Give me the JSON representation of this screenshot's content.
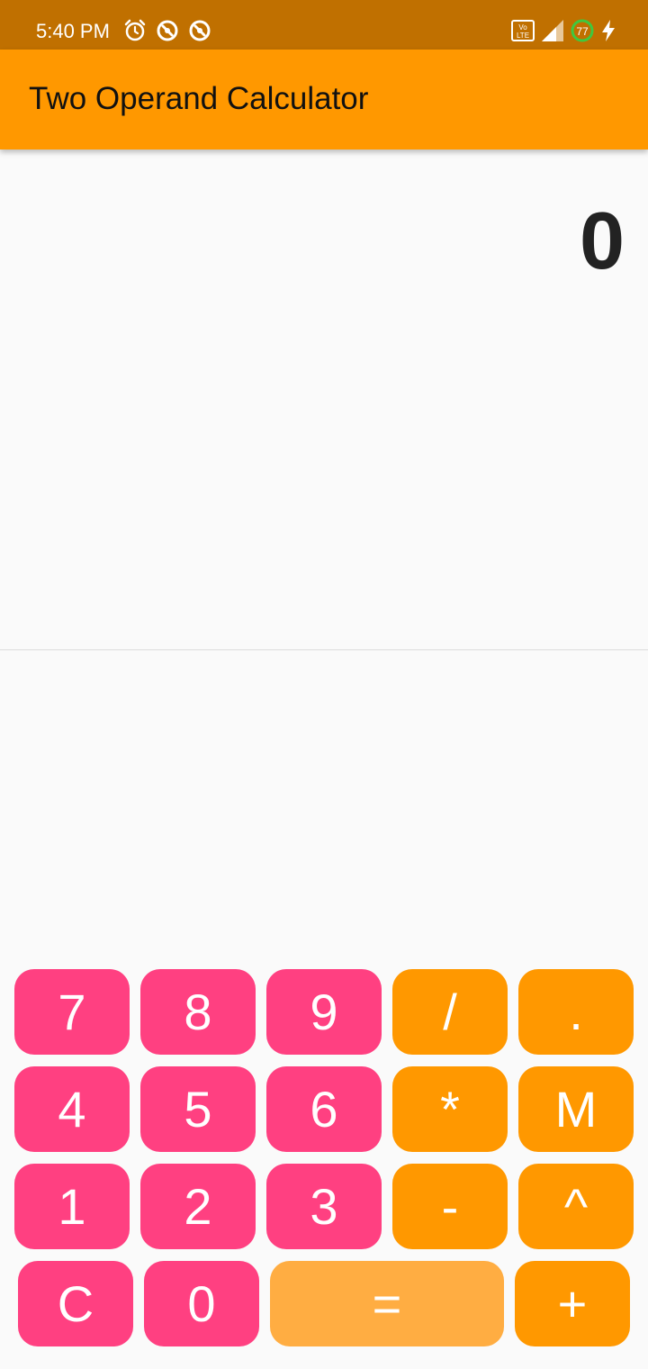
{
  "status_bar": {
    "time": "5:40 PM",
    "battery": "77",
    "icons": [
      "alarm-icon",
      "sync-icon",
      "sync-icon",
      "volte-icon",
      "signal-icon",
      "battery-icon",
      "charging-icon"
    ]
  },
  "app_bar": {
    "title": "Two Operand Calculator"
  },
  "display": {
    "value": "0"
  },
  "keypad": {
    "row1": [
      "7",
      "8",
      "9",
      "/",
      "."
    ],
    "row2": [
      "4",
      "5",
      "6",
      "*",
      "M"
    ],
    "row3": [
      "1",
      "2",
      "3",
      "-",
      "^"
    ],
    "row4": [
      "C",
      "0",
      "=",
      "+"
    ]
  },
  "colors": {
    "status_bar": "#c07000",
    "app_bar": "#ff9800",
    "number_key": "#ff4081",
    "operator_key": "#ff9800",
    "equals_key": "#ffad42",
    "background": "#fafafa"
  }
}
